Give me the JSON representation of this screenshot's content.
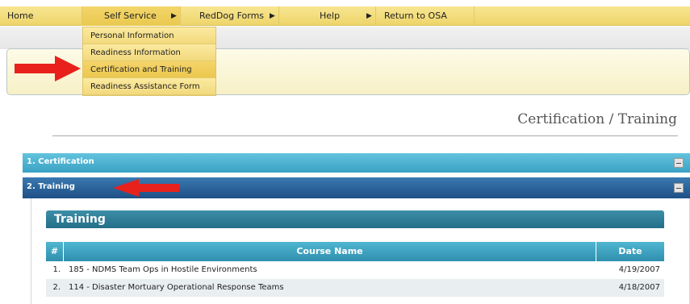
{
  "menubar": {
    "items": [
      {
        "label": "Home"
      },
      {
        "label": "Self Service"
      },
      {
        "label": "RedDog Forms"
      },
      {
        "label": "Help"
      },
      {
        "label": "Return to OSA Menu"
      }
    ]
  },
  "dropdown": {
    "items": [
      {
        "label": "Personal Information"
      },
      {
        "label": "Readiness Information"
      },
      {
        "label": "Certification and Training"
      },
      {
        "label": "Readiness Assistance Form"
      }
    ]
  },
  "page": {
    "title": "Certification / Training"
  },
  "sections": {
    "certification": {
      "label": "1. Certification"
    },
    "training": {
      "label": "2. Training"
    }
  },
  "training": {
    "heading": "Training",
    "columns": {
      "num": "#",
      "course": "Course Name",
      "date": "Date Completed"
    },
    "rows": [
      {
        "num": "1.",
        "course": "185 - NDMS Team Ops in Hostile Environments",
        "date": "4/19/2007"
      },
      {
        "num": "2.",
        "course": "114 - Disaster Mortuary Operational Response Teams",
        "date": "4/18/2007"
      }
    ]
  },
  "colors": {
    "menu": "#f2db78",
    "accent_arrow": "#e8211c",
    "section_light": "#3aa2c4",
    "section_dark": "#1e4f86"
  }
}
